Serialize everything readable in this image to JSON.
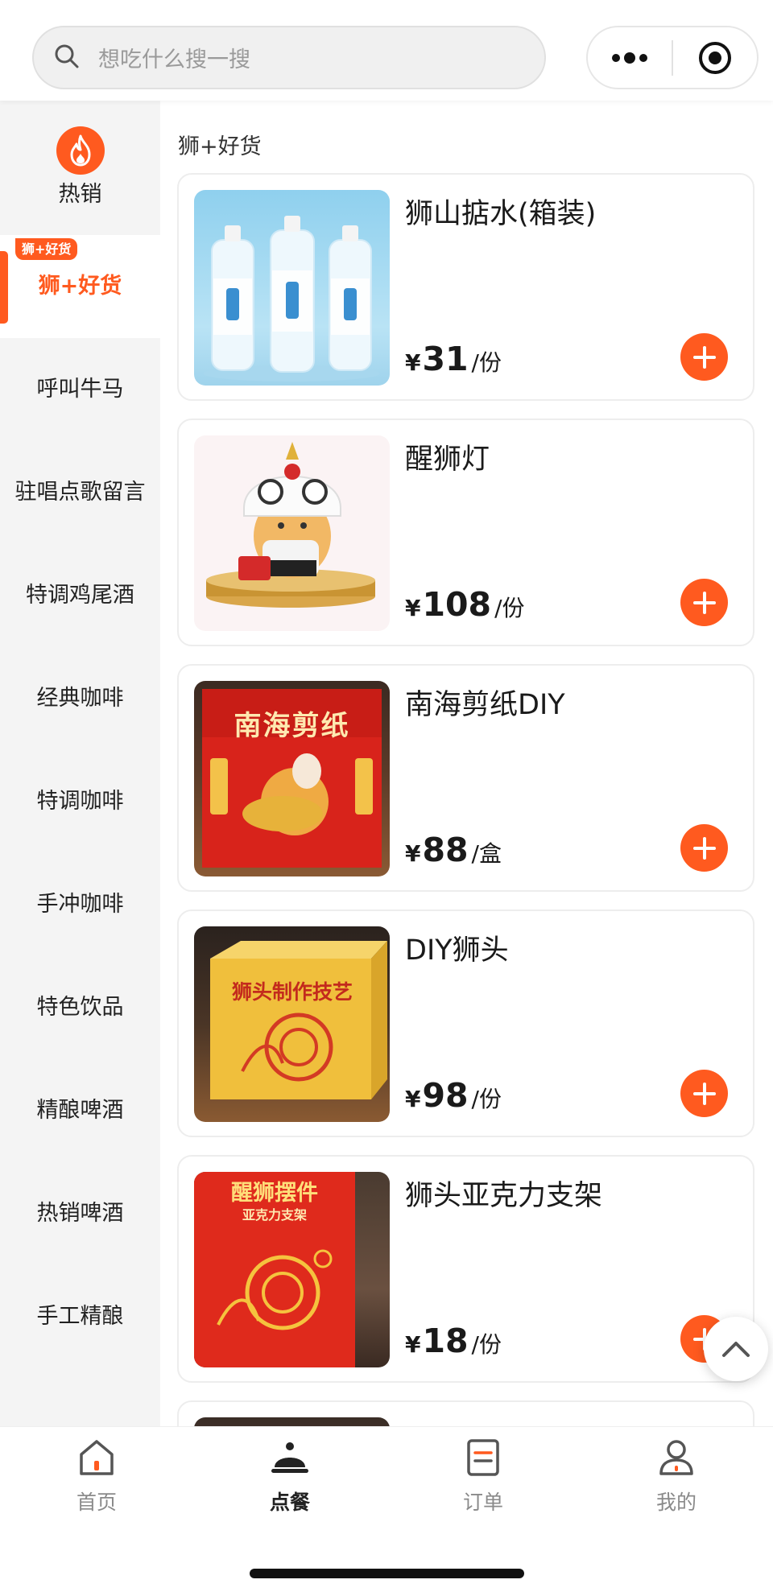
{
  "search": {
    "placeholder": "想吃什么搜一搜"
  },
  "sidebar": {
    "items": [
      {
        "label": "热销"
      },
      {
        "label": "狮+好货",
        "tag": "狮+好货"
      },
      {
        "label": "呼叫牛马"
      },
      {
        "label": "驻唱点歌留言"
      },
      {
        "label": "特调鸡尾酒"
      },
      {
        "label": "经典咖啡"
      },
      {
        "label": "特调咖啡"
      },
      {
        "label": "手冲咖啡"
      },
      {
        "label": "特色饮品"
      },
      {
        "label": "精酿啤酒"
      },
      {
        "label": "热销啤酒"
      },
      {
        "label": "手工精酿"
      }
    ]
  },
  "main": {
    "section_title": "狮+好货",
    "products": [
      {
        "name": "狮山掂水(箱装)",
        "currency": "¥",
        "price": "31",
        "unit": "/份"
      },
      {
        "name": "醒狮灯",
        "currency": "¥",
        "price": "108",
        "unit": "/份"
      },
      {
        "name": "南海剪纸DIY",
        "currency": "¥",
        "price": "88",
        "unit": "/盒",
        "image_text": "南海剪纸"
      },
      {
        "name": "DIY狮头",
        "currency": "¥",
        "price": "98",
        "unit": "/份",
        "image_text": "狮头制作技艺"
      },
      {
        "name": "狮头亚克力支架",
        "currency": "¥",
        "price": "18",
        "unit": "/份",
        "image_text": "醒狮摆件",
        "image_subtext": "亚克力支架"
      }
    ]
  },
  "tabbar": {
    "tabs": [
      {
        "label": "首页"
      },
      {
        "label": "点餐"
      },
      {
        "label": "订单"
      },
      {
        "label": "我的"
      }
    ]
  },
  "colors": {
    "accent": "#ff5a1f"
  }
}
